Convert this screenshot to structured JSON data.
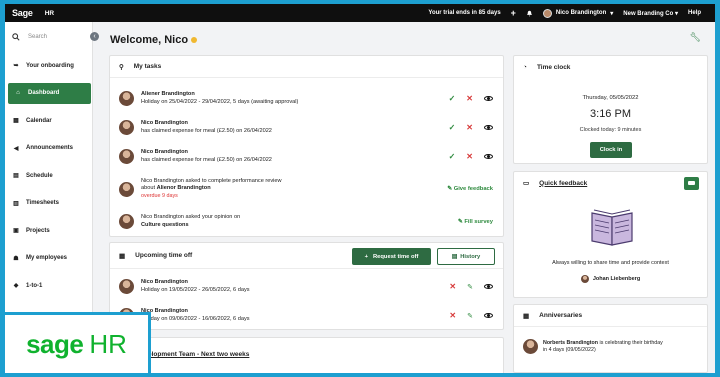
{
  "topbar": {
    "logo": "Sage",
    "product": "HR",
    "trial": "Your trial ends in 85 days",
    "user": "Nico Brandington",
    "company": "New Branding Co",
    "help": "Help"
  },
  "sidebar": {
    "search_placeholder": "Search",
    "items": [
      {
        "label": "Your onboarding",
        "icon": "onboarding-icon"
      },
      {
        "label": "Dashboard",
        "icon": "home-icon"
      },
      {
        "label": "Calendar",
        "icon": "calendar-icon"
      },
      {
        "label": "Announcements",
        "icon": "megaphone-icon"
      },
      {
        "label": "Schedule",
        "icon": "schedule-icon"
      },
      {
        "label": "Timesheets",
        "icon": "timesheet-icon"
      },
      {
        "label": "Projects",
        "icon": "briefcase-icon"
      },
      {
        "label": "My employees",
        "icon": "employees-icon"
      },
      {
        "label": "1-to-1",
        "icon": "chat-icon"
      }
    ]
  },
  "main": {
    "welcome": "Welcome, Nico"
  },
  "tasks": {
    "title": "My tasks",
    "items": [
      {
        "name": "Aliener Brandington",
        "detail": "Holiday on 25/04/2022 - 29/04/2022, 5 days (awaiting approval)"
      },
      {
        "name": "Nico Brandington",
        "detail": "has claimed expense for meal (£2.50) on 26/04/2022"
      },
      {
        "name": "Nico Brandington",
        "detail": "has claimed expense for meal (£2.50) on 26/04/2022"
      },
      {
        "line1": "Nico Brandington asked to complete performance review",
        "line2_prefix": "about",
        "line2_name": "Alienor Brandington",
        "overdue": "overdue 9 days",
        "action": "Give feedback"
      },
      {
        "line1": "Nico Brandington asked your opinion on",
        "line2_name": "Culture questions",
        "action": "Fill survey"
      }
    ]
  },
  "timeoff": {
    "title": "Upcoming time off",
    "request_label": "Request time off",
    "history_label": "History",
    "items": [
      {
        "name": "Nico Brandington",
        "detail": "Holiday on 19/05/2022 - 26/05/2022, 6 days"
      },
      {
        "name": "Nico Brandington",
        "detail": "Holiday on 09/06/2022 - 16/06/2022, 6 days"
      }
    ]
  },
  "dev": {
    "title": "elopment Team - Next two weeks"
  },
  "timeclock": {
    "title": "Time clock",
    "date": "Thursday, 05/05/2022",
    "time": "3:16 PM",
    "closed": "Clocked today: 9 minutes",
    "clock_in": "Clock in"
  },
  "feedback": {
    "title": "Quick feedback",
    "prompt": "Always willing to share time and provide context",
    "person": "Johan Liebenberg"
  },
  "anniversaries": {
    "title": "Anniversaries",
    "name": "Norberts Brandington",
    "text": "is celebrating their birthday",
    "when": "in 4 days (09/05/2022)"
  },
  "brand": {
    "sage": "sage",
    "hr": "HR"
  },
  "colors": {
    "accent": "#2e7d46",
    "frame": "#1d9fd0",
    "brand": "#10b22e"
  }
}
